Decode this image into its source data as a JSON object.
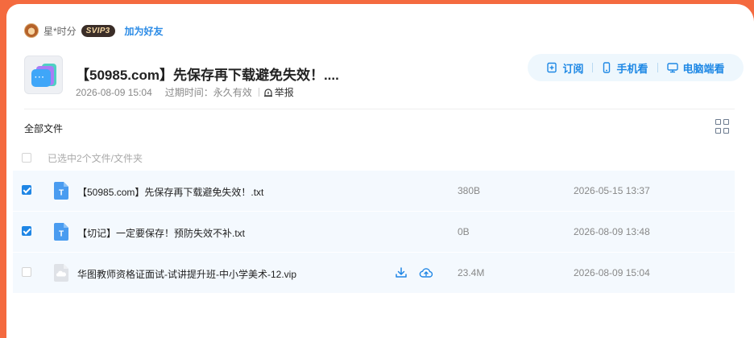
{
  "user": {
    "name": "星*时分",
    "badge": "SVIP3",
    "add_friend": "加为好友"
  },
  "share": {
    "title": "【50985.com】先保存再下载避免失效！....",
    "created": "2026-08-09 15:04",
    "expiry_label": "过期时间：",
    "expiry_value": "永久有效",
    "report": "举报"
  },
  "actions": {
    "subscribe": "订阅",
    "mobile": "手机看",
    "desktop": "电脑端看"
  },
  "breadcrumb": "全部文件",
  "selection_info": "已选中2个文件/文件夹",
  "files": [
    {
      "name": "【50985.com】先保存再下载避免失效！.txt",
      "size": "380B",
      "date": "2026-05-15 13:37",
      "checked": true,
      "type": "txt"
    },
    {
      "name": "【切记】一定要保存！预防失效不补.txt",
      "size": "0B",
      "date": "2026-08-09 13:48",
      "checked": true,
      "type": "txt"
    },
    {
      "name": "华图教师资格证面试-试讲提升班-中小学美术-12.vip",
      "size": "23.4M",
      "date": "2026-08-09 15:04",
      "checked": false,
      "type": "unknown"
    }
  ],
  "icons": {
    "row_download": "download-icon",
    "row_save": "cloud-upload-icon",
    "view_toggle": "grid-view-icon"
  },
  "colors": {
    "accent": "#1f86e5",
    "outer_background": "#f46a3f",
    "row_highlight": "#f4f9fe"
  }
}
